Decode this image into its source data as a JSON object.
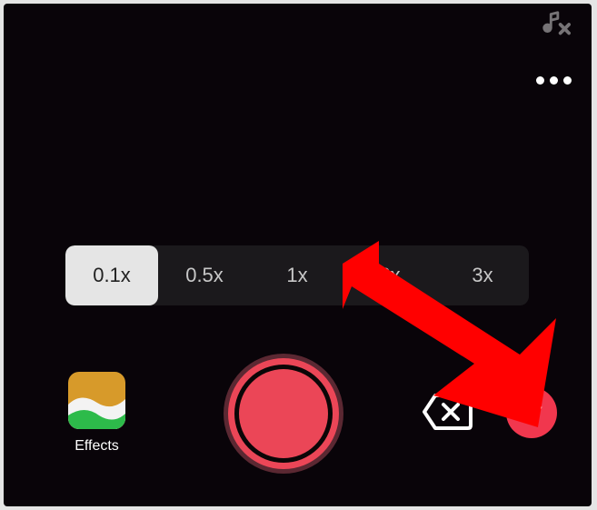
{
  "speed": {
    "options": [
      "0.1x",
      "0.5x",
      "1x",
      "2x",
      "3x"
    ],
    "selected_index": 0
  },
  "effects": {
    "label": "Effects"
  },
  "colors": {
    "accent": "#eb4657",
    "confirm": "#f1374e",
    "annotation": "#ff0000"
  },
  "icons": {
    "music_cut": "music-cut-icon",
    "more": "more-icon",
    "delete_last": "delete-last-icon",
    "checkmark": "checkmark-icon"
  }
}
